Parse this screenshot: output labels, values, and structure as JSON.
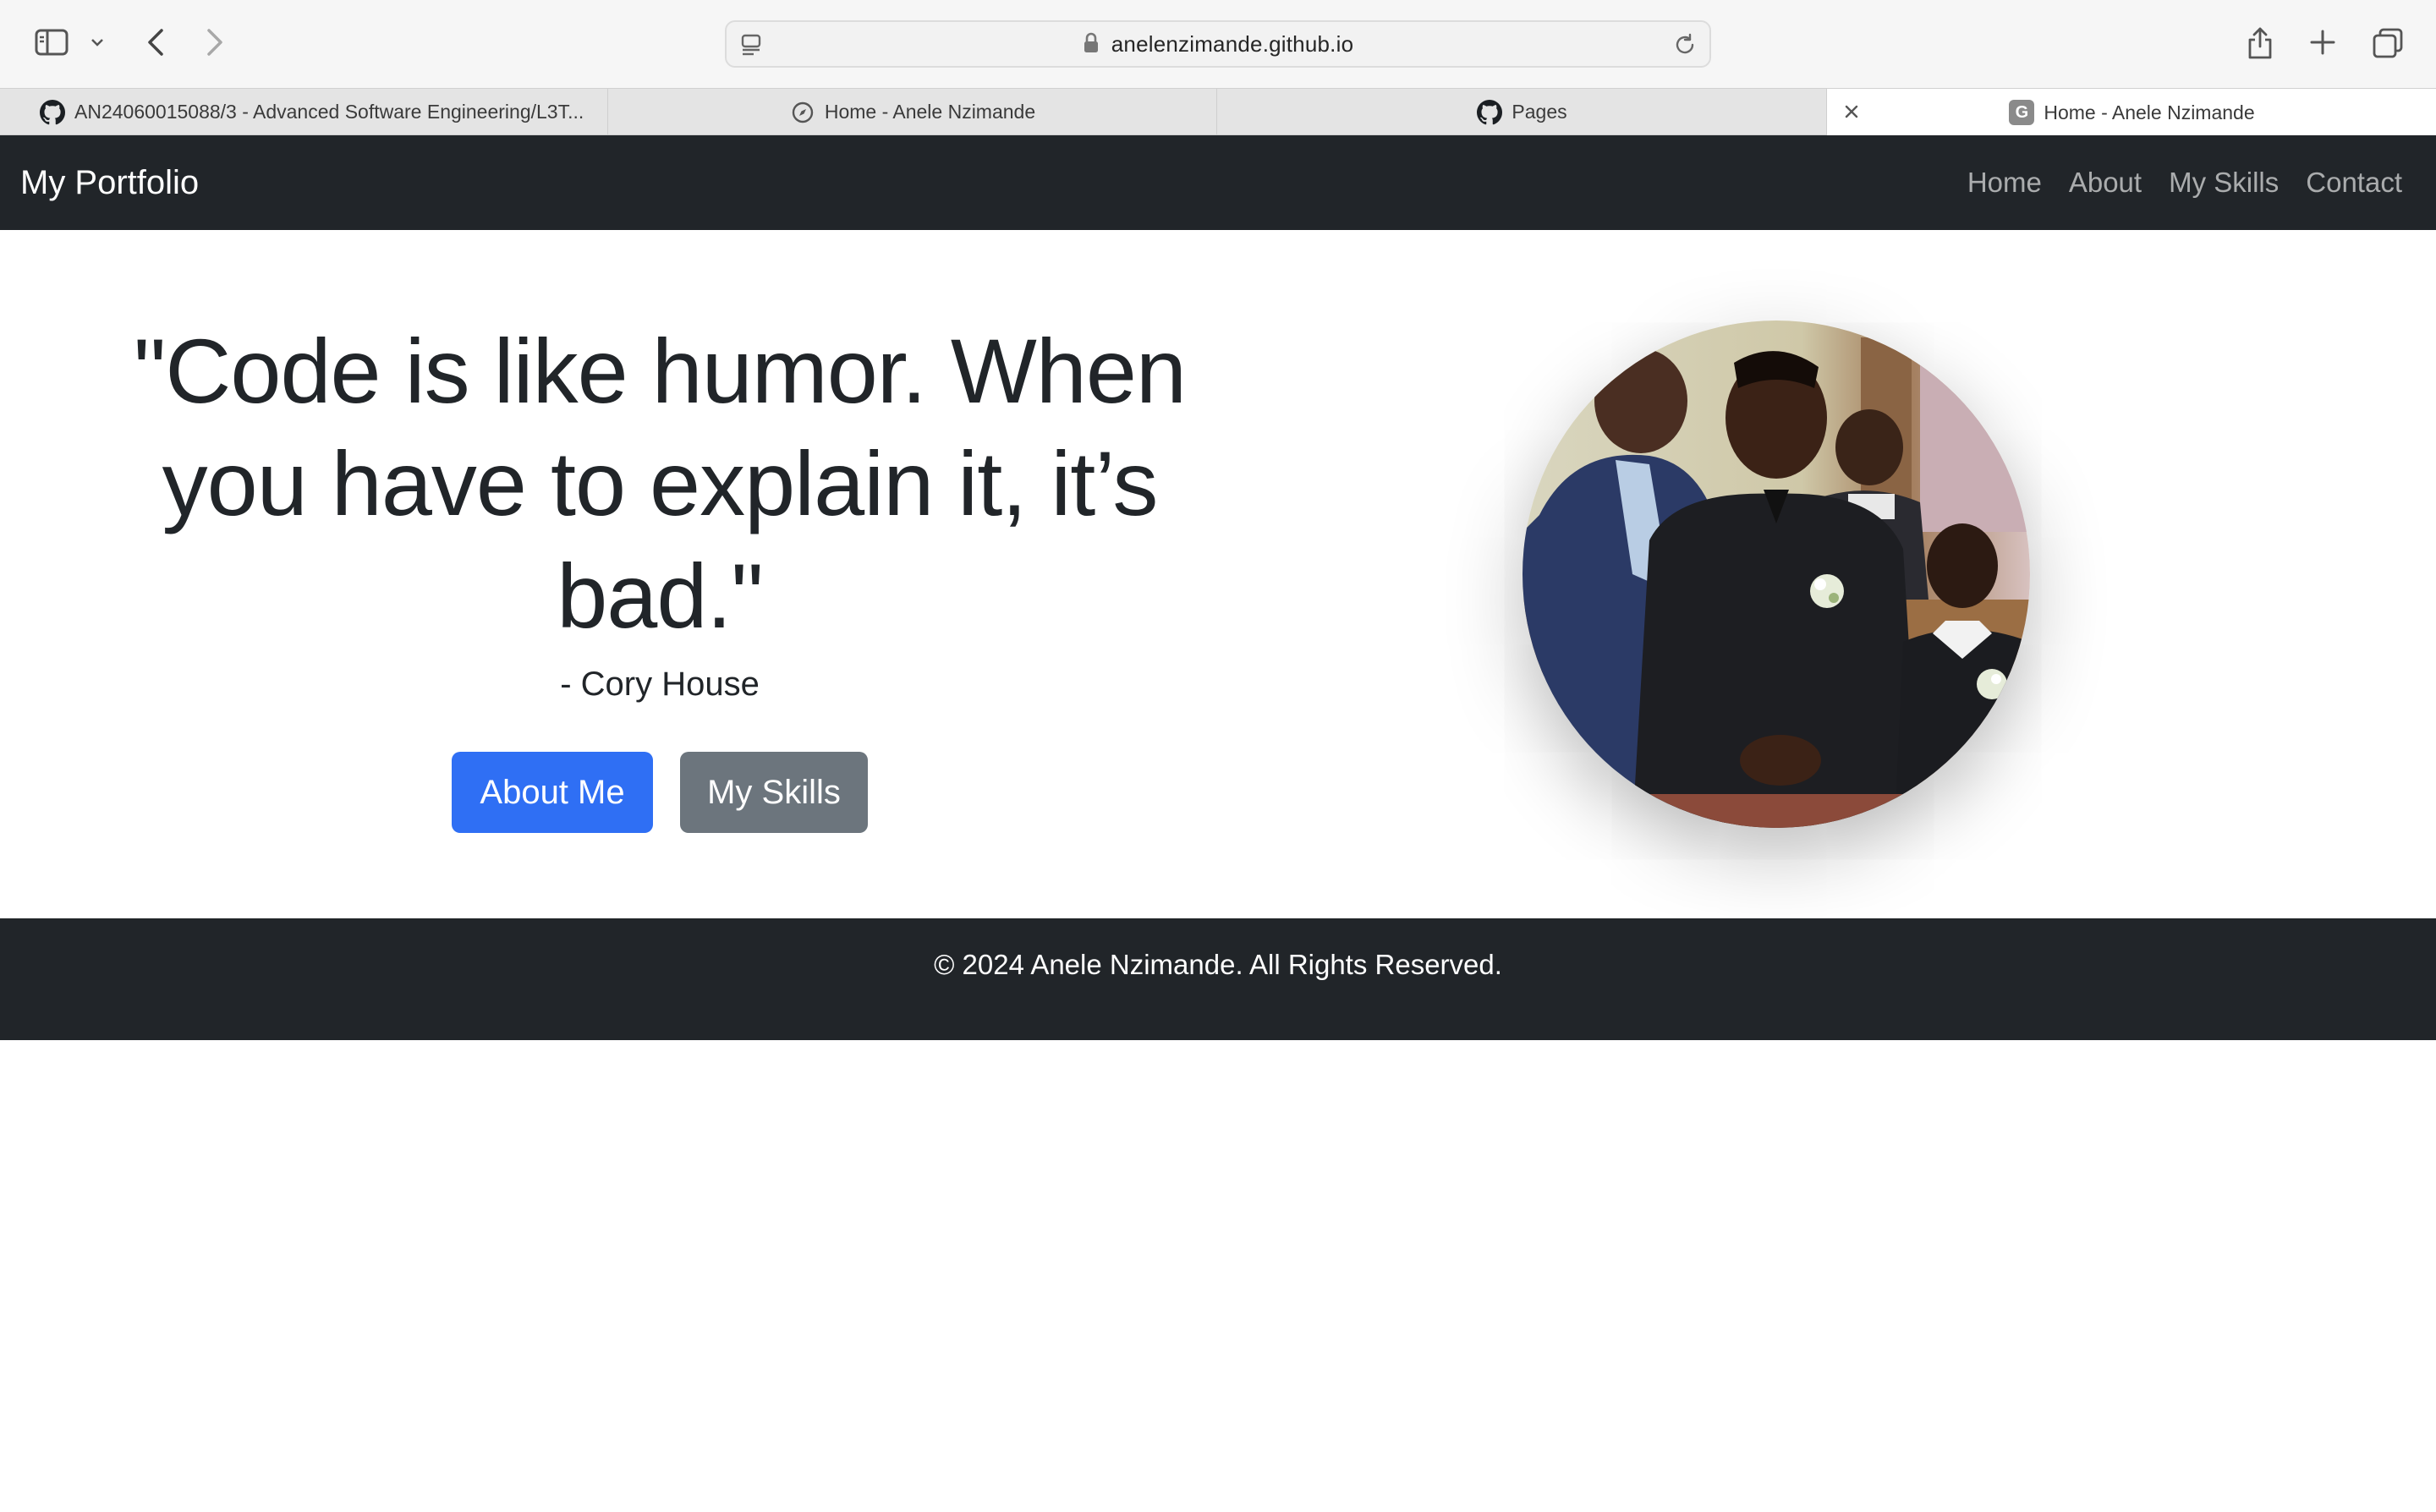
{
  "browser": {
    "url": "anelenzimande.github.io",
    "tabs": [
      {
        "title": "AN24060015088/3 - Advanced Software Engineering/L3T...",
        "favicon": "github-icon"
      },
      {
        "title": "Home - Anele Nzimande",
        "favicon": "compass-icon"
      },
      {
        "title": "Pages",
        "favicon": "github-icon"
      },
      {
        "title": "Home - Anele Nzimande",
        "favicon": "g-letter-icon",
        "favicon_letter": "G",
        "active": true
      }
    ]
  },
  "navbar": {
    "brand": "My Portfolio",
    "links": [
      "Home",
      "About",
      "My Skills",
      "Contact"
    ]
  },
  "hero": {
    "quote_line1": "\"Code is like humor. When",
    "quote_line2": "you have to explain it, it’s",
    "quote_line3": "bad.\"",
    "author": "- Cory House",
    "primary_button": "About Me",
    "secondary_button": "My Skills",
    "photo_alt": "group-portrait-photo"
  },
  "footer": {
    "text": "© 2024 Anele Nzimande. All Rights Reserved."
  },
  "colors": {
    "navbar_bg": "#212529",
    "primary": "#2f6ff4",
    "secondary": "#6c757d"
  }
}
